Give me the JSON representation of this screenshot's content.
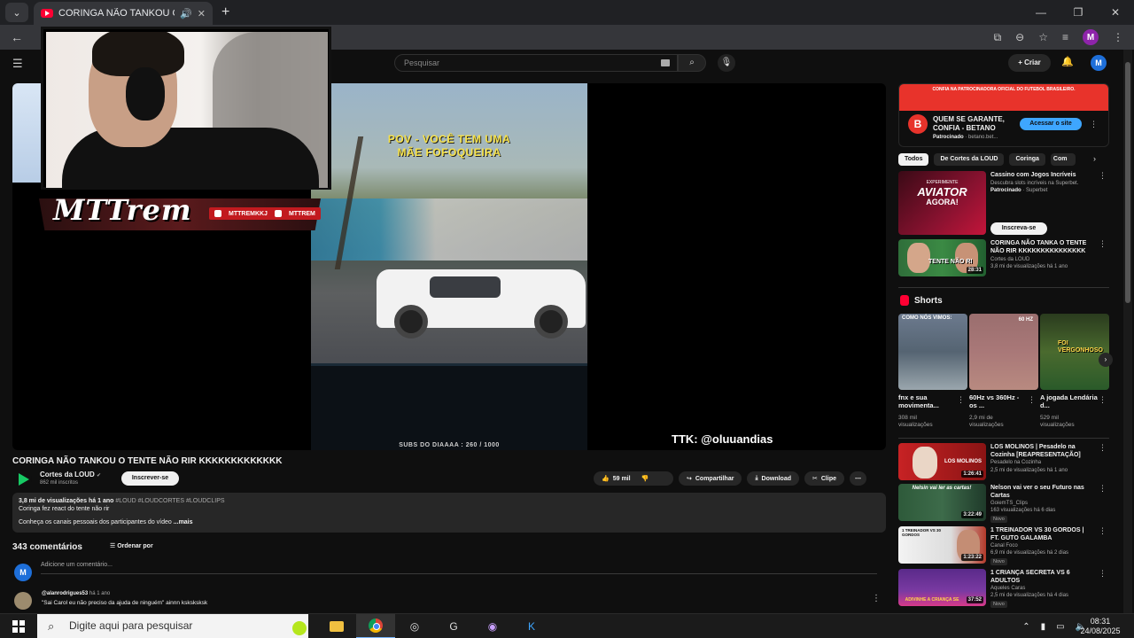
{
  "browser": {
    "tab_title": "CORINGA NÃO TANKOU O",
    "new_tab_label": "+",
    "window_controls": [
      "—",
      "❐",
      "✕"
    ],
    "profile_initial": "M"
  },
  "youtube": {
    "search_placeholder": "Pesquisar",
    "create_label": "Criar",
    "avatar_initial": "M"
  },
  "video": {
    "overlay_text_line1": "POV - VOCÊ TEM UMA",
    "overlay_text_line2": "MÃE FOFOQUEIRA",
    "subs_counter": "SUBS DO DIAAAA : 260 / 1000",
    "ttk_handle": "TTK: @oluuandias",
    "streamer_logo": "MTTREM",
    "social_1": "MTTREMKKJ",
    "social_2": "MTTREM"
  },
  "video_info": {
    "title": "CORINGA NÃO TANKOU O TENTE NÃO RIR KKKKKKKKKKKKK",
    "channel": "Cortes da LOUD",
    "subscribers": "862 mil inscritos",
    "subscribe_label": "Inscrever-se",
    "likes": "59 mil",
    "share_label": "Compartilhar",
    "download_label": "Download",
    "clip_label": "Clipe",
    "views_date": "3,8 mi de visualizações  há 1 ano",
    "hashtags": "#LOUD #LOUDCORTES #LOUDCLIPS",
    "desc_line1": "Coringa fez react do tente não rir",
    "desc_line2": "Conheça os canais pessoais dos participantes do vídeo",
    "desc_more": "...mais"
  },
  "comments": {
    "count_label": "343 comentários",
    "sort_label": "Ordenar por",
    "user_initial": "M",
    "add_placeholder": "Adicione um comentário...",
    "first": {
      "user": "@alanrodrigues53",
      "time": "há 1 ano",
      "text": "\"Sai Carol eu não preciso da ajuda de ninguém\" ainnn ksksksksk"
    }
  },
  "sidebar": {
    "ad": {
      "top_text": "CONFIA NA PATROCINADORA OFICIAL DO FUTEBOL BRASILEIRO.",
      "logo_letter": "B",
      "title": "QUEM SE GARANTE, CONFIA - BETANO",
      "sponsored": "Patrocinado",
      "domain": "betano.bet...",
      "cta": "Acessar o site"
    },
    "chips": [
      "Todos",
      "De Cortes da LOUD",
      "Coringa",
      "Com"
    ],
    "rec_ad": {
      "title": "Cassino com Jogos Incríveis",
      "desc": "Descubra slots incríveis na Superbet.",
      "sponsored": "Patrocinado",
      "advertiser": "Superbet",
      "thumb_text1": "EXPERIMENTE",
      "thumb_text2": "AVIATOR",
      "thumb_text3": "AGORA!",
      "button": "Inscreva-se"
    },
    "rec1": {
      "title": "CORINGA NÃO TANKA O TENTE NÃO RIR KKKKKKKKKKKKKKK",
      "channel": "Cortes da LOUD",
      "meta": "3,8 mi de visualizações  há 1 ano",
      "duration": "28:31",
      "thumb_text": "TENTE NÃO RI"
    },
    "shorts_label": "Shorts",
    "shorts": [
      {
        "title": "fnx e sua movimenta...",
        "meta1": "308 mil",
        "meta2": "visualizações",
        "thumb_text": "COMO NÓS VIMOS:"
      },
      {
        "title": "60Hz vs 360Hz - os ...",
        "meta1": "2,9 mi de",
        "meta2": "visualizações",
        "thumb_text": "60 HZ"
      },
      {
        "title": "A jogada Lendária d...",
        "meta1": "529 mil",
        "meta2": "visualizações",
        "thumb_text": "FOI VERGONHOSO"
      }
    ],
    "videos": [
      {
        "title": "LOS MOLINOS | Pesadelo na Cozinha [REAPRESENTAÇÃO]",
        "channel": "Pesadelo na Cozinha",
        "meta": "2,5 mi de visualizações  há 1 ano",
        "duration": "1:26:41",
        "thumb_text": "LOS MOLINOS",
        "new": ""
      },
      {
        "title": "Nelson vai ver o seu Futuro nas Cartas",
        "channel": "GoiemTS_Clips",
        "meta": "163 visualizações  há 6 dias",
        "duration": "3:22:49",
        "thumb_text": "Nelsin vai ler as cartas!",
        "new": "Novo"
      },
      {
        "title": "1 TREINADOR VS 30 GORDOS | FT. GUTO GALAMBA",
        "channel": "Canal Foco",
        "meta": "6,9 mi de visualizações  há 2 dias",
        "duration": "1:23:22",
        "thumb_text": "1 TREINADOR VS 30 GORDOS",
        "new": "Novo"
      },
      {
        "title": "1 CRIANÇA SECRETA VS 6 ADULTOS",
        "channel": "Aqueles Caras",
        "meta": "2,5 mi de visualizações  há 4 dias",
        "duration": "37:52",
        "thumb_text": "ADIVINHE A CRIANÇA SE",
        "new": "Novo"
      }
    ]
  },
  "taskbar": {
    "search_placeholder": "Digite aqui para pesquisar",
    "time": "08:31",
    "date": "24/08/2025"
  }
}
